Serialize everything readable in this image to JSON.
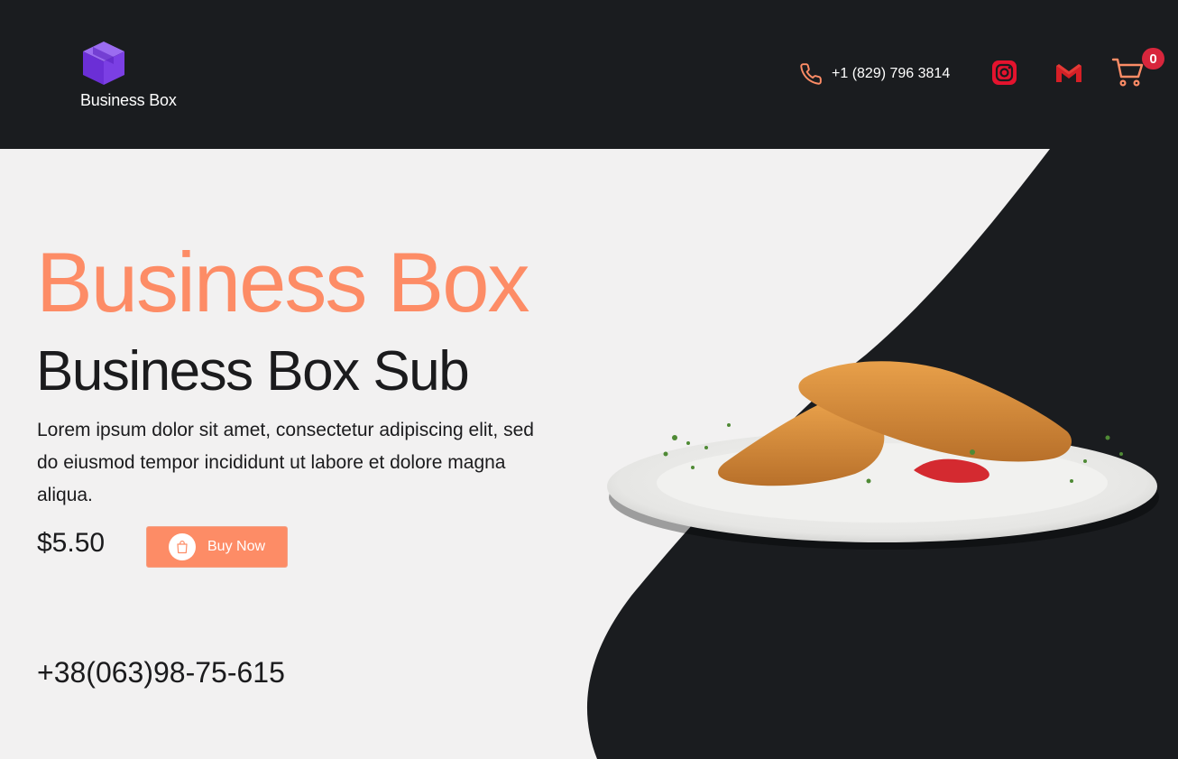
{
  "header": {
    "logo_text": "Business Box",
    "phone": "+1 (829) 796 3814",
    "cart_count": "0",
    "icons": [
      "box-logo-icon",
      "phone-icon",
      "instagram-icon",
      "gmail-icon",
      "cart-icon"
    ]
  },
  "hero": {
    "title": "Business Box",
    "subtitle": "Business Box Sub",
    "description": "Lorem ipsum dolor sit amet, consectetur adipiscing elit, sed do eiusmod tempor incididunt ut labore et dolore magna aliqua.",
    "price": "$5.50",
    "buy_label": "Buy Now",
    "contact_phone": "+38(063)98-75-615"
  },
  "colors": {
    "accent": "#fd8c66",
    "dark": "#1a1c1f",
    "light_bg": "#f2f1f1",
    "badge": "#d8263c",
    "logo_purple": "#7b3fe4"
  }
}
